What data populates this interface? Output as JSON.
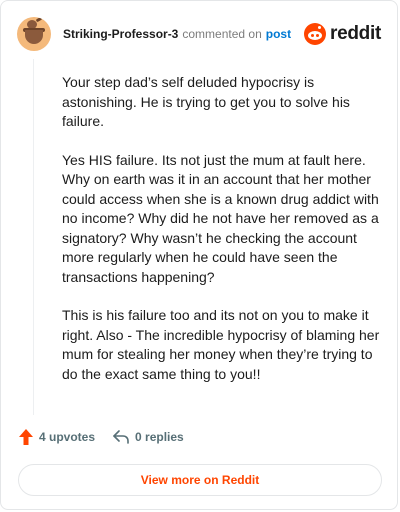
{
  "comment": {
    "username": "Striking-Professor-3",
    "action_text": "commented on",
    "post_link_text": "post",
    "brand_text": "reddit",
    "paragraphs": [
      "Your step dad’s self deluded hypocrisy is astonishing. He is trying to get you to solve his failure.",
      "Yes HIS failure. Its not just the mum at fault here. Why on earth was it in an account that her mother could access when she is a known drug addict with no income? Why did he not have her removed as a signatory? Why wasn’t he checking the account more regularly when he could have seen the transactions happening?",
      "This is his failure too and its not on you to make it right. Also - The incredible hypocrisy of blaming her mum for stealing her money when they’re trying to do the exact same thing to you!!"
    ],
    "upvotes_text": "4 upvotes",
    "replies_text": "0 replies",
    "view_button_label": "View more on Reddit"
  },
  "colors": {
    "accent": "#ff4500",
    "link": "#0079d3",
    "muted": "#576f76"
  },
  "icons": {
    "avatar": "avatar-icon",
    "brand": "reddit-icon",
    "upvote": "upvote-arrow-icon",
    "reply": "reply-arrow-icon"
  }
}
